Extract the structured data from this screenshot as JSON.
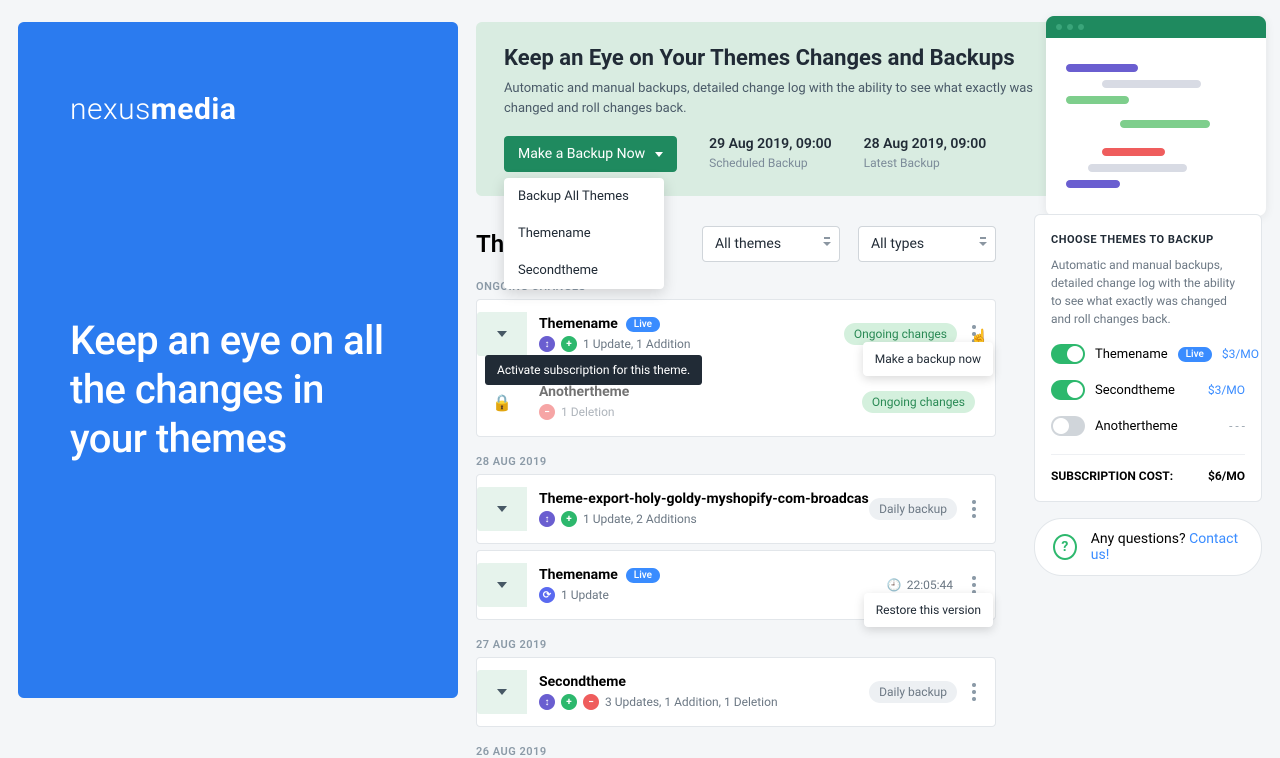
{
  "hero": {
    "logo_light": "nexus",
    "logo_bold": "media",
    "title": "Keep an eye on all the changes in your themes"
  },
  "banner": {
    "title": "Keep an Eye on Your Themes Changes and Backups",
    "subtitle": "Automatic and manual backups, detailed change log with the ability to see what exactly was changed and roll changes back.",
    "backup_button": "Make a Backup Now",
    "dropdown": [
      "Backup All Themes",
      "Themename",
      "Secondtheme"
    ],
    "scheduled_date": "29 Aug 2019, 09:00",
    "scheduled_label": "Scheduled Backup",
    "latest_date": "28 Aug 2019, 09:00",
    "latest_label": "Latest Backup"
  },
  "filters": {
    "heading_clipped": "Th",
    "themes": "All themes",
    "types": "All types"
  },
  "labels": {
    "ongoing": "ONGOING CHANGES",
    "aug28": "28 AUG 2019",
    "aug27": "27 AUG 2019",
    "aug26": "26 AUG 2019",
    "tooltip": "Activate subscription for this theme.",
    "make_backup": "Make a backup now",
    "restore": "Restore this version",
    "live": "Live"
  },
  "rows": {
    "r1": {
      "name": "Themename",
      "meta": "1 Update, 1 Addition",
      "pill": "Ongoing changes"
    },
    "r2": {
      "name": "Anothertheme",
      "meta": "1 Deletion",
      "pill": "Ongoing changes"
    },
    "r3": {
      "name": "Theme-export-holy-goldy-myshopify-com-broadcas",
      "meta": "1 Update, 2 Additions",
      "pill": "Daily backup"
    },
    "r4": {
      "name": "Themename",
      "meta": "1 Update",
      "time": "22:05:44"
    },
    "r5": {
      "name": "Secondtheme",
      "meta": "3 Updates, 1 Addition, 1 Deletion",
      "pill": "Daily backup"
    }
  },
  "sidebar": {
    "title": "CHOOSE THEMES TO BACKUP",
    "text": "Automatic and manual backups, detailed change log  with the ability to see what exactly was changed and roll changes back.",
    "items": [
      {
        "name": "Themename",
        "on": true,
        "live": true,
        "price": "$3/MO"
      },
      {
        "name": "Secondtheme",
        "on": true,
        "live": false,
        "price": "$3/MO"
      },
      {
        "name": "Anothertheme",
        "on": false,
        "live": false,
        "price": "- - -"
      }
    ],
    "cost_label": "SUBSCRIPTION COST:",
    "cost_value": "$6/MO",
    "contact_q": "Any questions? ",
    "contact_link": "Contact us!"
  }
}
